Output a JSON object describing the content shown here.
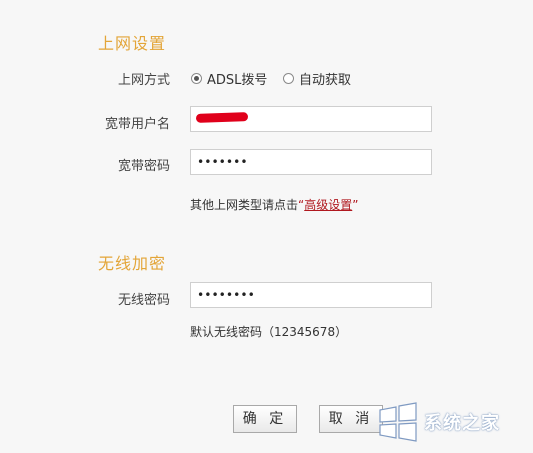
{
  "internet": {
    "title": "上网设置",
    "mode_label": "上网方式",
    "mode_options": [
      {
        "label": "ADSL拨号",
        "selected": true
      },
      {
        "label": "自动获取",
        "selected": false
      }
    ],
    "username_label": "宽带用户名",
    "username_value": "",
    "password_label": "宽带密码",
    "password_value": "•••••••",
    "hint_prefix": "其他上网类型请点击",
    "hint_quote_open": "“",
    "hint_link": "高级设置",
    "hint_quote_close": "”"
  },
  "wireless": {
    "title": "无线加密",
    "password_label": "无线密码",
    "password_value": "••••••••",
    "default_hint": "默认无线密码（12345678）"
  },
  "buttons": {
    "confirm": "确 定",
    "cancel": "取 消"
  },
  "colors": {
    "section_title": "#e3a538",
    "link": "#b0181f",
    "redaction": "#e0001b"
  },
  "watermark_icon": "windows-logo-icon"
}
